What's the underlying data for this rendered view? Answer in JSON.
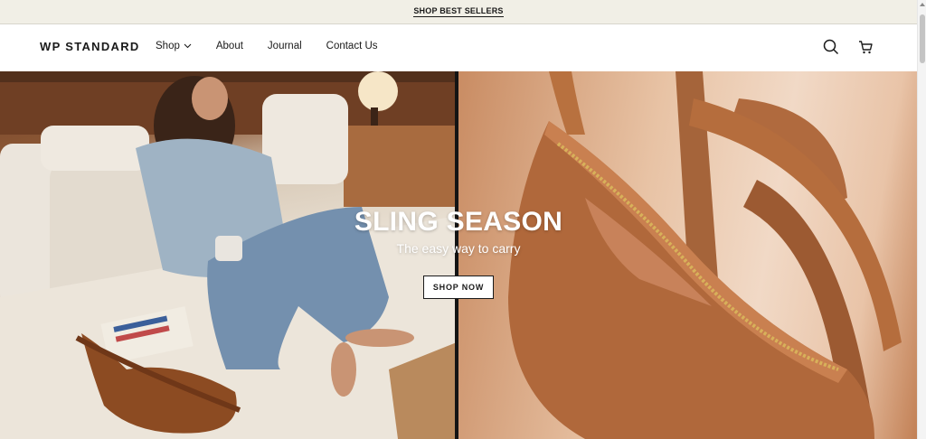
{
  "announcement": {
    "text": "SHOP BEST SELLERS"
  },
  "header": {
    "logo": "WP STANDARD",
    "nav": [
      {
        "label": "Shop",
        "has_dropdown": true
      },
      {
        "label": "About"
      },
      {
        "label": "Journal"
      },
      {
        "label": "Contact Us"
      }
    ],
    "icons": [
      "search-icon",
      "cart-icon"
    ]
  },
  "hero": {
    "title": "SLING SEASON",
    "subtitle": "The easy way to carry",
    "cta": "SHOP NOW"
  },
  "colors": {
    "announcement_bg": "#f1efe6",
    "leather": "#b0683b",
    "text": "#1a1a1a"
  }
}
